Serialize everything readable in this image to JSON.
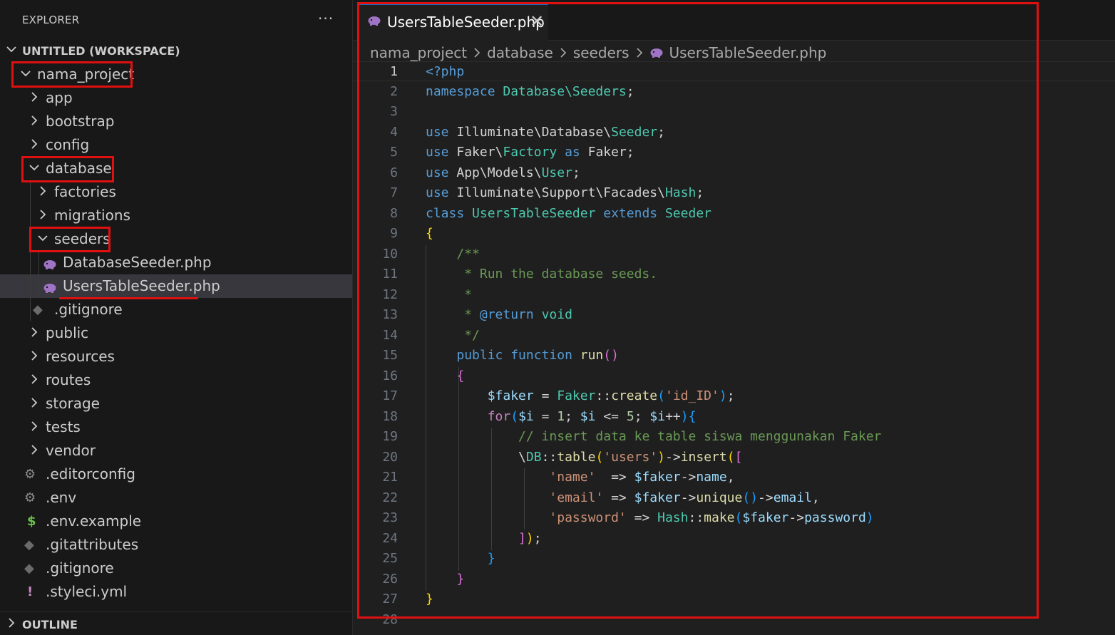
{
  "sidebar": {
    "title": "EXPLORER",
    "more_actions": "···",
    "workspace": "UNTITLED (WORKSPACE)",
    "outline": "OUTLINE",
    "tree": [
      {
        "label": "nama_project",
        "type": "folder",
        "open": true,
        "depth": 0
      },
      {
        "label": "app",
        "type": "folder",
        "open": false,
        "depth": 1
      },
      {
        "label": "bootstrap",
        "type": "folder",
        "open": false,
        "depth": 1
      },
      {
        "label": "config",
        "type": "folder",
        "open": false,
        "depth": 1
      },
      {
        "label": "database",
        "type": "folder",
        "open": true,
        "depth": 1
      },
      {
        "label": "factories",
        "type": "folder",
        "open": false,
        "depth": 2
      },
      {
        "label": "migrations",
        "type": "folder",
        "open": false,
        "depth": 2
      },
      {
        "label": "seeders",
        "type": "folder",
        "open": true,
        "depth": 2
      },
      {
        "label": "DatabaseSeeder.php",
        "type": "file",
        "icon": "php-elephant-icon",
        "depth": 3
      },
      {
        "label": "UsersTableSeeder.php",
        "type": "file",
        "icon": "php-elephant-icon",
        "depth": 3,
        "selected": true
      },
      {
        "label": ".gitignore",
        "type": "file",
        "icon": "git-icon",
        "depth": 2
      },
      {
        "label": "public",
        "type": "folder",
        "open": false,
        "depth": 1
      },
      {
        "label": "resources",
        "type": "folder",
        "open": false,
        "depth": 1
      },
      {
        "label": "routes",
        "type": "folder",
        "open": false,
        "depth": 1
      },
      {
        "label": "storage",
        "type": "folder",
        "open": false,
        "depth": 1
      },
      {
        "label": "tests",
        "type": "folder",
        "open": false,
        "depth": 1
      },
      {
        "label": "vendor",
        "type": "folder",
        "open": false,
        "depth": 1
      },
      {
        "label": ".editorconfig",
        "type": "file",
        "icon": "gear-icon",
        "depth": 1
      },
      {
        "label": ".env",
        "type": "file",
        "icon": "gear-icon",
        "depth": 1
      },
      {
        "label": ".env.example",
        "type": "file",
        "icon": "dollar-icon",
        "depth": 1
      },
      {
        "label": ".gitattributes",
        "type": "file",
        "icon": "git-icon",
        "depth": 1
      },
      {
        "label": ".gitignore",
        "type": "file",
        "icon": "git-icon",
        "depth": 1
      },
      {
        "label": ".styleci.yml",
        "type": "file",
        "icon": "exclamation-icon",
        "depth": 1
      }
    ]
  },
  "colors": {
    "highlight_box": "#e01010",
    "php_icon": "#a074c4",
    "selected_row": "#37373d",
    "accent": "#0078d4"
  },
  "editor": {
    "tab_label": "UsersTableSeeder.php",
    "tab_close": "✕",
    "breadcrumb": [
      "nama_project",
      "database",
      "seeders",
      "UsersTableSeeder.php"
    ],
    "active_line": 1,
    "lines": [
      {
        "n": "1",
        "t": [
          [
            "kw",
            "<?php"
          ]
        ]
      },
      {
        "n": "2",
        "t": [
          [
            "kw",
            "namespace "
          ],
          [
            "cls",
            "Database\\Seeders"
          ],
          [
            "txt",
            ";"
          ]
        ]
      },
      {
        "n": "3",
        "t": []
      },
      {
        "n": "4",
        "t": [
          [
            "kw",
            "use "
          ],
          [
            "txt",
            "Illuminate\\Database\\"
          ],
          [
            "cls",
            "Seeder"
          ],
          [
            "txt",
            ";"
          ]
        ]
      },
      {
        "n": "5",
        "t": [
          [
            "kw",
            "use "
          ],
          [
            "txt",
            "Faker\\"
          ],
          [
            "cls",
            "Factory"
          ],
          [
            "kw",
            " as "
          ],
          [
            "txt",
            "Faker;"
          ]
        ]
      },
      {
        "n": "6",
        "t": [
          [
            "kw",
            "use "
          ],
          [
            "txt",
            "App\\Models\\"
          ],
          [
            "cls",
            "User"
          ],
          [
            "txt",
            ";"
          ]
        ]
      },
      {
        "n": "7",
        "t": [
          [
            "kw",
            "use "
          ],
          [
            "txt",
            "Illuminate\\Support\\Facades\\"
          ],
          [
            "cls",
            "Hash"
          ],
          [
            "txt",
            ";"
          ]
        ]
      },
      {
        "n": "8",
        "t": [
          [
            "kw",
            "class "
          ],
          [
            "cls",
            "UsersTableSeeder"
          ],
          [
            "kw",
            " extends "
          ],
          [
            "cls",
            "Seeder"
          ]
        ]
      },
      {
        "n": "9",
        "t": [
          [
            "b1",
            "{"
          ]
        ]
      },
      {
        "n": "10",
        "t": [
          [
            "txt",
            "    "
          ],
          [
            "cmt",
            "/**"
          ]
        ]
      },
      {
        "n": "11",
        "t": [
          [
            "txt",
            "     "
          ],
          [
            "cmt",
            "* Run the database seeds."
          ]
        ]
      },
      {
        "n": "12",
        "t": [
          [
            "txt",
            "     "
          ],
          [
            "cmt",
            "*"
          ]
        ]
      },
      {
        "n": "13",
        "t": [
          [
            "txt",
            "     "
          ],
          [
            "cmt",
            "* "
          ],
          [
            "kw",
            "@return"
          ],
          [
            "cmt",
            " "
          ],
          [
            "cls",
            "void"
          ]
        ]
      },
      {
        "n": "14",
        "t": [
          [
            "txt",
            "     "
          ],
          [
            "cmt",
            "*/"
          ]
        ]
      },
      {
        "n": "15",
        "t": [
          [
            "txt",
            "    "
          ],
          [
            "kw",
            "public function "
          ],
          [
            "fn",
            "run"
          ],
          [
            "b2",
            "()"
          ]
        ]
      },
      {
        "n": "16",
        "t": [
          [
            "txt",
            "    "
          ],
          [
            "b2",
            "{"
          ]
        ]
      },
      {
        "n": "17",
        "t": [
          [
            "txt",
            "        "
          ],
          [
            "var",
            "$faker"
          ],
          [
            "txt",
            " = "
          ],
          [
            "cls",
            "Faker"
          ],
          [
            "txt",
            "::"
          ],
          [
            "fn",
            "create"
          ],
          [
            "b3",
            "("
          ],
          [
            "str",
            "'id_ID'"
          ],
          [
            "b3",
            ")"
          ],
          [
            "txt",
            ";"
          ]
        ]
      },
      {
        "n": "18",
        "t": [
          [
            "txt",
            "        "
          ],
          [
            "ctrl",
            "for"
          ],
          [
            "b3",
            "("
          ],
          [
            "var",
            "$i"
          ],
          [
            "txt",
            " = "
          ],
          [
            "num",
            "1"
          ],
          [
            "txt",
            "; "
          ],
          [
            "var",
            "$i"
          ],
          [
            "txt",
            " <= "
          ],
          [
            "num",
            "5"
          ],
          [
            "txt",
            "; "
          ],
          [
            "var",
            "$i"
          ],
          [
            "txt",
            "++"
          ],
          [
            "b3",
            ")"
          ],
          [
            "b3",
            "{"
          ]
        ]
      },
      {
        "n": "19",
        "t": [
          [
            "txt",
            "            "
          ],
          [
            "cmt",
            "// insert data ke table siswa menggunakan Faker"
          ]
        ]
      },
      {
        "n": "20",
        "t": [
          [
            "txt",
            "            \\"
          ],
          [
            "cls",
            "DB"
          ],
          [
            "txt",
            "::"
          ],
          [
            "fn",
            "table"
          ],
          [
            "b1",
            "("
          ],
          [
            "str",
            "'users'"
          ],
          [
            "b1",
            ")"
          ],
          [
            "txt",
            "->"
          ],
          [
            "fn",
            "insert"
          ],
          [
            "b1",
            "("
          ],
          [
            "b2",
            "["
          ]
        ]
      },
      {
        "n": "21",
        "t": [
          [
            "txt",
            "                "
          ],
          [
            "str",
            "'name'"
          ],
          [
            "txt",
            "  => "
          ],
          [
            "var",
            "$faker"
          ],
          [
            "txt",
            "->"
          ],
          [
            "var",
            "name"
          ],
          [
            "txt",
            ","
          ]
        ]
      },
      {
        "n": "22",
        "t": [
          [
            "txt",
            "                "
          ],
          [
            "str",
            "'email'"
          ],
          [
            "txt",
            " => "
          ],
          [
            "var",
            "$faker"
          ],
          [
            "txt",
            "->"
          ],
          [
            "fn",
            "unique"
          ],
          [
            "b3",
            "()"
          ],
          [
            "txt",
            "->"
          ],
          [
            "var",
            "email"
          ],
          [
            "txt",
            ","
          ]
        ]
      },
      {
        "n": "23",
        "t": [
          [
            "txt",
            "                "
          ],
          [
            "str",
            "'password'"
          ],
          [
            "txt",
            " => "
          ],
          [
            "cls",
            "Hash"
          ],
          [
            "txt",
            "::"
          ],
          [
            "fn",
            "make"
          ],
          [
            "b3",
            "("
          ],
          [
            "var",
            "$faker"
          ],
          [
            "txt",
            "->"
          ],
          [
            "var",
            "password"
          ],
          [
            "b3",
            ")"
          ]
        ]
      },
      {
        "n": "24",
        "t": [
          [
            "txt",
            "            "
          ],
          [
            "b2",
            "]"
          ],
          [
            "b1",
            ")"
          ],
          [
            "txt",
            ";"
          ]
        ]
      },
      {
        "n": "25",
        "t": [
          [
            "txt",
            "        "
          ],
          [
            "b3",
            "}"
          ]
        ]
      },
      {
        "n": "26",
        "t": [
          [
            "txt",
            "    "
          ],
          [
            "b2",
            "}"
          ]
        ]
      },
      {
        "n": "27",
        "t": [
          [
            "b1",
            "}"
          ]
        ]
      },
      {
        "n": "28",
        "t": []
      }
    ]
  }
}
